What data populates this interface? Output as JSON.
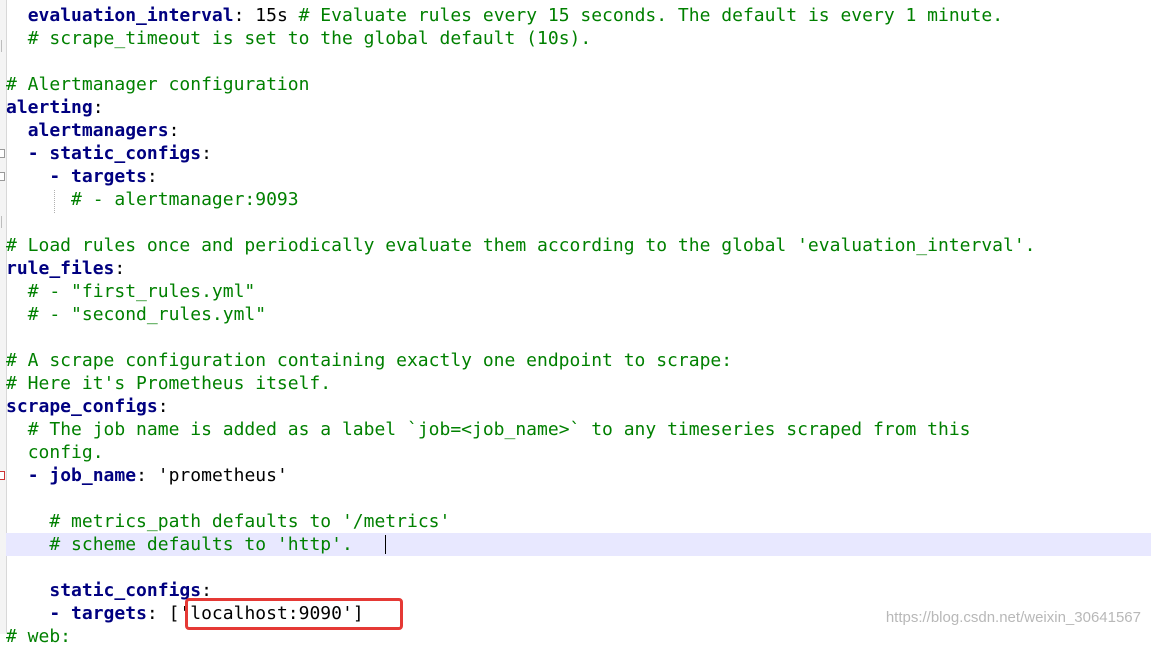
{
  "editor": {
    "lines": [
      {
        "indent": "  ",
        "key": "evaluation_interval",
        "colon": ":",
        "value": " 15s ",
        "comment": "# Evaluate rules every 15 seconds. The default is every 1 minute."
      },
      {
        "indent": "  ",
        "comment": "# scrape_timeout is set to the global default (10s)."
      },
      {},
      {
        "comment": "# Alertmanager configuration"
      },
      {
        "key": "alerting",
        "colon": ":"
      },
      {
        "indent": "  ",
        "key": "alertmanagers",
        "colon": ":"
      },
      {
        "indent": "  ",
        "dash": "- ",
        "key": "static_configs",
        "colon": ":"
      },
      {
        "indent": "    ",
        "dash": "- ",
        "key": "targets",
        "colon": ":"
      },
      {
        "indent": "      ",
        "comment": "# - alertmanager:9093"
      },
      {},
      {
        "comment": "# Load rules once and periodically evaluate them according to the global 'evaluation_interval'."
      },
      {
        "key": "rule_files",
        "colon": ":"
      },
      {
        "indent": "  ",
        "comment": "# - \"first_rules.yml\""
      },
      {
        "indent": "  ",
        "comment": "# - \"second_rules.yml\""
      },
      {},
      {
        "comment": "# A scrape configuration containing exactly one endpoint to scrape:"
      },
      {
        "comment": "# Here it's Prometheus itself."
      },
      {
        "key": "scrape_configs",
        "colon": ":"
      },
      {
        "indent": "  ",
        "comment": "# The job name is added as a label `job=<job_name>` to any timeseries scraped from this"
      },
      {
        "indent": "  ",
        "comment": "config."
      },
      {
        "indent": "  ",
        "dash": "- ",
        "key": "job_name",
        "colon": ":",
        "value": " 'prometheus'"
      },
      {},
      {
        "indent": "    ",
        "comment": "# metrics_path defaults to '/metrics'"
      },
      {
        "indent": "    ",
        "comment": "# scheme defaults to 'http'."
      },
      {},
      {
        "indent": "    ",
        "key": "static_configs",
        "colon": ":"
      },
      {
        "indent": "    ",
        "dash": "- ",
        "key": "targets",
        "colon": ":",
        "value": " ['localhost:9090']"
      },
      {
        "comment": "# web:"
      }
    ]
  },
  "annotation": {
    "label": "['localhost:9090']",
    "color": "#e53935"
  },
  "watermark": "https://blog.csdn.net/weixin_30641567",
  "colors": {
    "comment": "#008000",
    "key": "#000080",
    "current_line": "#e8e8ff"
  }
}
